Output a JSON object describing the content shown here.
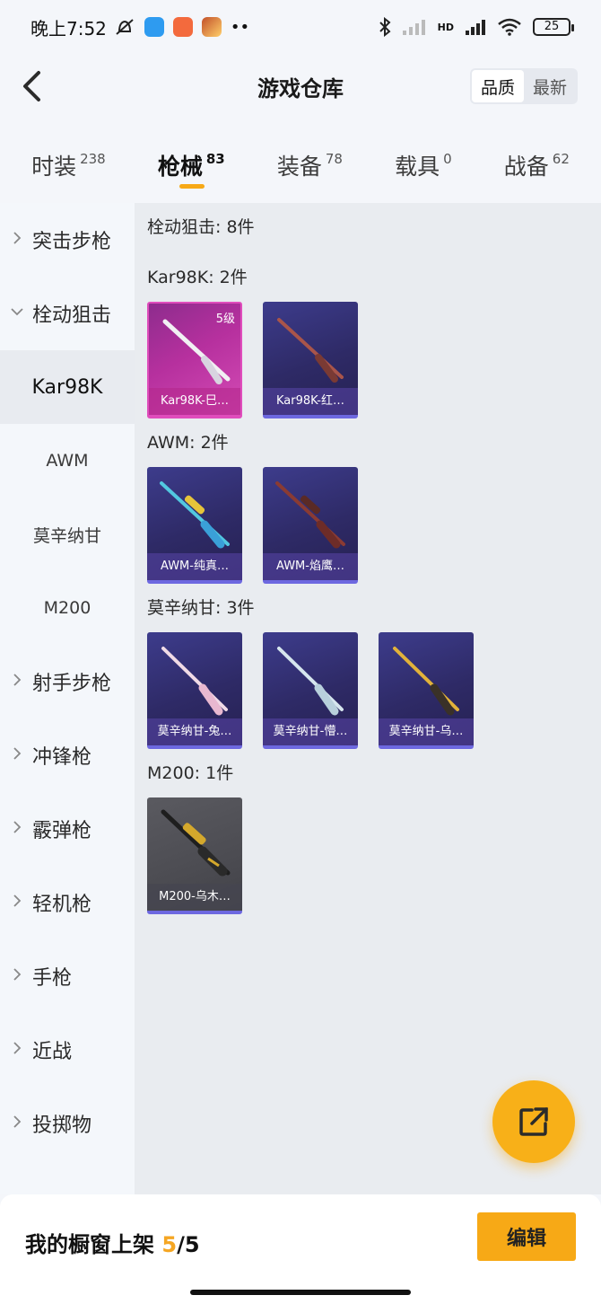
{
  "status": {
    "time": "晚上7:52",
    "battery": "25",
    "network": "HD"
  },
  "header": {
    "title": "游戏仓库",
    "sort_options": [
      "品质",
      "最新"
    ],
    "sort_active": "品质"
  },
  "tabs": [
    {
      "label": "时装",
      "count": "238"
    },
    {
      "label": "枪械",
      "count": "83"
    },
    {
      "label": "装备",
      "count": "78"
    },
    {
      "label": "载具",
      "count": "0"
    },
    {
      "label": "战备",
      "count": "62"
    }
  ],
  "sidebar": {
    "categories_before": [
      "突击步枪"
    ],
    "expanded": "栓动狙击",
    "sub_items": [
      "Kar98K",
      "AWM",
      "莫辛纳甘",
      "M200"
    ],
    "categories_after": [
      "射手步枪",
      "冲锋枪",
      "霰弹枪",
      "轻机枪",
      "手枪",
      "近战",
      "投掷物"
    ]
  },
  "content": {
    "section_title": "栓动狙击: 8件",
    "groups": [
      {
        "title": "Kar98K: 2件",
        "items": [
          {
            "name": "Kar98K-巳…",
            "level": "5级",
            "rarity": "legend"
          },
          {
            "name": "Kar98K-红…",
            "level": "",
            "rarity": "epic"
          }
        ]
      },
      {
        "title": "AWM: 2件",
        "items": [
          {
            "name": "AWM-纯真…",
            "level": "",
            "rarity": "epic"
          },
          {
            "name": "AWM-焰鹰…",
            "level": "",
            "rarity": "epic"
          }
        ]
      },
      {
        "title": "莫辛纳甘: 3件",
        "items": [
          {
            "name": "莫辛纳甘-兔…",
            "level": "",
            "rarity": "epic"
          },
          {
            "name": "莫辛纳甘-懵…",
            "level": "",
            "rarity": "epic"
          },
          {
            "name": "莫辛纳甘-乌…",
            "level": "",
            "rarity": "epic"
          }
        ]
      },
      {
        "title": "M200: 1件",
        "items": [
          {
            "name": "M200-乌木…",
            "level": "",
            "rarity": "dark"
          }
        ]
      }
    ]
  },
  "bottom": {
    "label": "我的橱窗上架",
    "current": "5",
    "total": "/5",
    "edit": "编辑"
  },
  "colors": {
    "accent": "#f7a916",
    "legend": "#d44bb5",
    "epic": "#3d3c8c"
  }
}
